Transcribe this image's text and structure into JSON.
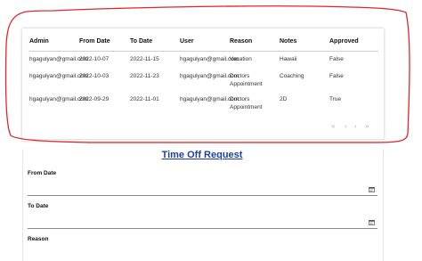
{
  "table": {
    "columns": [
      "Admin",
      "From Date",
      "To Date",
      "User",
      "Reason",
      "Notes",
      "Approved"
    ],
    "rows": [
      {
        "admin": "hgagulyan@gmail.com",
        "from": "2022-10-07",
        "to": "2022-11-15",
        "user": "hgagulyan@gmail.com",
        "reason": "Vacation",
        "notes": "Hawaii",
        "approved": "False"
      },
      {
        "admin": "hgagulyan@gmail.com",
        "from": "2022-10-03",
        "to": "2022-11-23",
        "user": "hgagulyan@gmail.com",
        "reason": "Doctors\nAppointment",
        "notes": "Coaching",
        "approved": "False"
      },
      {
        "admin": "hgagulyan@gmail.com",
        "from": "2022-09-29",
        "to": "2022-11-01",
        "user": "hgagulyan@gmail.com",
        "reason": "Doctors\nAppointment",
        "notes": "2D",
        "approved": "True"
      }
    ],
    "pager": {
      "first": "«",
      "prev": "‹",
      "next": "›",
      "last": "»"
    }
  },
  "form": {
    "title": "Time Off Request",
    "from_label": "From Date",
    "to_label": "To Date",
    "reason_label": "Reason",
    "calendar_icon": "calendar-icon"
  },
  "annotation": {
    "color": "#e0262a"
  }
}
